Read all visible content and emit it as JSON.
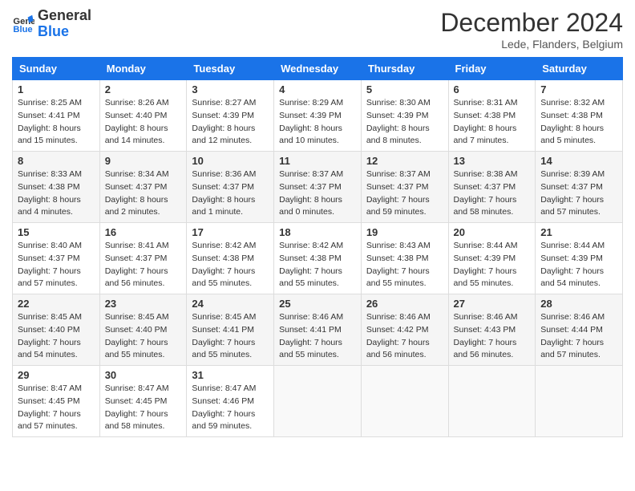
{
  "header": {
    "logo_line1": "General",
    "logo_line2": "Blue",
    "month": "December 2024",
    "location": "Lede, Flanders, Belgium"
  },
  "weekdays": [
    "Sunday",
    "Monday",
    "Tuesday",
    "Wednesday",
    "Thursday",
    "Friday",
    "Saturday"
  ],
  "weeks": [
    [
      {
        "day": "1",
        "sunrise": "8:25 AM",
        "sunset": "4:41 PM",
        "daylight": "8 hours and 15 minutes."
      },
      {
        "day": "2",
        "sunrise": "8:26 AM",
        "sunset": "4:40 PM",
        "daylight": "8 hours and 14 minutes."
      },
      {
        "day": "3",
        "sunrise": "8:27 AM",
        "sunset": "4:39 PM",
        "daylight": "8 hours and 12 minutes."
      },
      {
        "day": "4",
        "sunrise": "8:29 AM",
        "sunset": "4:39 PM",
        "daylight": "8 hours and 10 minutes."
      },
      {
        "day": "5",
        "sunrise": "8:30 AM",
        "sunset": "4:39 PM",
        "daylight": "8 hours and 8 minutes."
      },
      {
        "day": "6",
        "sunrise": "8:31 AM",
        "sunset": "4:38 PM",
        "daylight": "8 hours and 7 minutes."
      },
      {
        "day": "7",
        "sunrise": "8:32 AM",
        "sunset": "4:38 PM",
        "daylight": "8 hours and 5 minutes."
      }
    ],
    [
      {
        "day": "8",
        "sunrise": "8:33 AM",
        "sunset": "4:38 PM",
        "daylight": "8 hours and 4 minutes."
      },
      {
        "day": "9",
        "sunrise": "8:34 AM",
        "sunset": "4:37 PM",
        "daylight": "8 hours and 2 minutes."
      },
      {
        "day": "10",
        "sunrise": "8:36 AM",
        "sunset": "4:37 PM",
        "daylight": "8 hours and 1 minute."
      },
      {
        "day": "11",
        "sunrise": "8:37 AM",
        "sunset": "4:37 PM",
        "daylight": "8 hours and 0 minutes."
      },
      {
        "day": "12",
        "sunrise": "8:37 AM",
        "sunset": "4:37 PM",
        "daylight": "7 hours and 59 minutes."
      },
      {
        "day": "13",
        "sunrise": "8:38 AM",
        "sunset": "4:37 PM",
        "daylight": "7 hours and 58 minutes."
      },
      {
        "day": "14",
        "sunrise": "8:39 AM",
        "sunset": "4:37 PM",
        "daylight": "7 hours and 57 minutes."
      }
    ],
    [
      {
        "day": "15",
        "sunrise": "8:40 AM",
        "sunset": "4:37 PM",
        "daylight": "7 hours and 57 minutes."
      },
      {
        "day": "16",
        "sunrise": "8:41 AM",
        "sunset": "4:37 PM",
        "daylight": "7 hours and 56 minutes."
      },
      {
        "day": "17",
        "sunrise": "8:42 AM",
        "sunset": "4:38 PM",
        "daylight": "7 hours and 55 minutes."
      },
      {
        "day": "18",
        "sunrise": "8:42 AM",
        "sunset": "4:38 PM",
        "daylight": "7 hours and 55 minutes."
      },
      {
        "day": "19",
        "sunrise": "8:43 AM",
        "sunset": "4:38 PM",
        "daylight": "7 hours and 55 minutes."
      },
      {
        "day": "20",
        "sunrise": "8:44 AM",
        "sunset": "4:39 PM",
        "daylight": "7 hours and 55 minutes."
      },
      {
        "day": "21",
        "sunrise": "8:44 AM",
        "sunset": "4:39 PM",
        "daylight": "7 hours and 54 minutes."
      }
    ],
    [
      {
        "day": "22",
        "sunrise": "8:45 AM",
        "sunset": "4:40 PM",
        "daylight": "7 hours and 54 minutes."
      },
      {
        "day": "23",
        "sunrise": "8:45 AM",
        "sunset": "4:40 PM",
        "daylight": "7 hours and 55 minutes."
      },
      {
        "day": "24",
        "sunrise": "8:45 AM",
        "sunset": "4:41 PM",
        "daylight": "7 hours and 55 minutes."
      },
      {
        "day": "25",
        "sunrise": "8:46 AM",
        "sunset": "4:41 PM",
        "daylight": "7 hours and 55 minutes."
      },
      {
        "day": "26",
        "sunrise": "8:46 AM",
        "sunset": "4:42 PM",
        "daylight": "7 hours and 56 minutes."
      },
      {
        "day": "27",
        "sunrise": "8:46 AM",
        "sunset": "4:43 PM",
        "daylight": "7 hours and 56 minutes."
      },
      {
        "day": "28",
        "sunrise": "8:46 AM",
        "sunset": "4:44 PM",
        "daylight": "7 hours and 57 minutes."
      }
    ],
    [
      {
        "day": "29",
        "sunrise": "8:47 AM",
        "sunset": "4:45 PM",
        "daylight": "7 hours and 57 minutes."
      },
      {
        "day": "30",
        "sunrise": "8:47 AM",
        "sunset": "4:45 PM",
        "daylight": "7 hours and 58 minutes."
      },
      {
        "day": "31",
        "sunrise": "8:47 AM",
        "sunset": "4:46 PM",
        "daylight": "7 hours and 59 minutes."
      },
      null,
      null,
      null,
      null
    ]
  ]
}
